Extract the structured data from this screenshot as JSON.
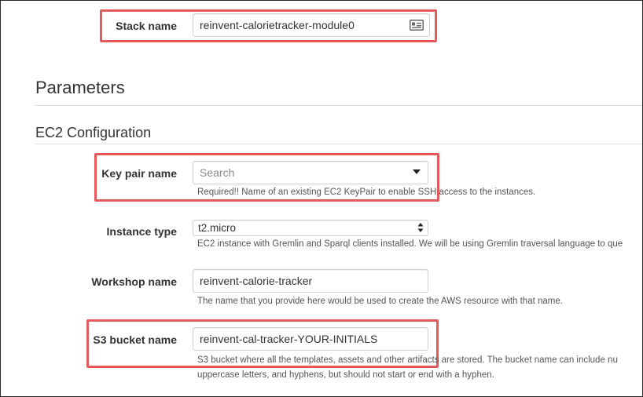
{
  "stack": {
    "label": "Stack name",
    "value": "reinvent-calorietracker-module0",
    "icon": "contact-card-icon"
  },
  "parameters": {
    "title": "Parameters"
  },
  "ec2_config": {
    "title": "EC2 Configuration"
  },
  "key_pair": {
    "label": "Key pair name",
    "placeholder": "Search",
    "icon": "caret-down-icon",
    "help": "Required!! Name of an existing EC2 KeyPair to enable SSH access to the instances."
  },
  "instance_type": {
    "label": "Instance type",
    "value": "t2.micro",
    "icon": "select-arrows-icon",
    "help": "EC2 instance with Gremlin and Sparql clients installed. We will be using Gremlin traversal language to que"
  },
  "workshop": {
    "label": "Workshop name",
    "value": "reinvent-calorie-tracker",
    "help": "The name that you provide here would be used to create the AWS resource with that name."
  },
  "s3_bucket": {
    "label": "S3 bucket name",
    "value": "reinvent-cal-tracker-YOUR-INITIALS",
    "help_line1": "S3 bucket where all the templates, assets and other artifacts are stored. The bucket name can include nu",
    "help_line2": "uppercase letters, and hyphens, but should not start or end with a hyphen."
  },
  "colors": {
    "highlight": "#e4595a",
    "text": "#333333",
    "help": "#555555"
  }
}
